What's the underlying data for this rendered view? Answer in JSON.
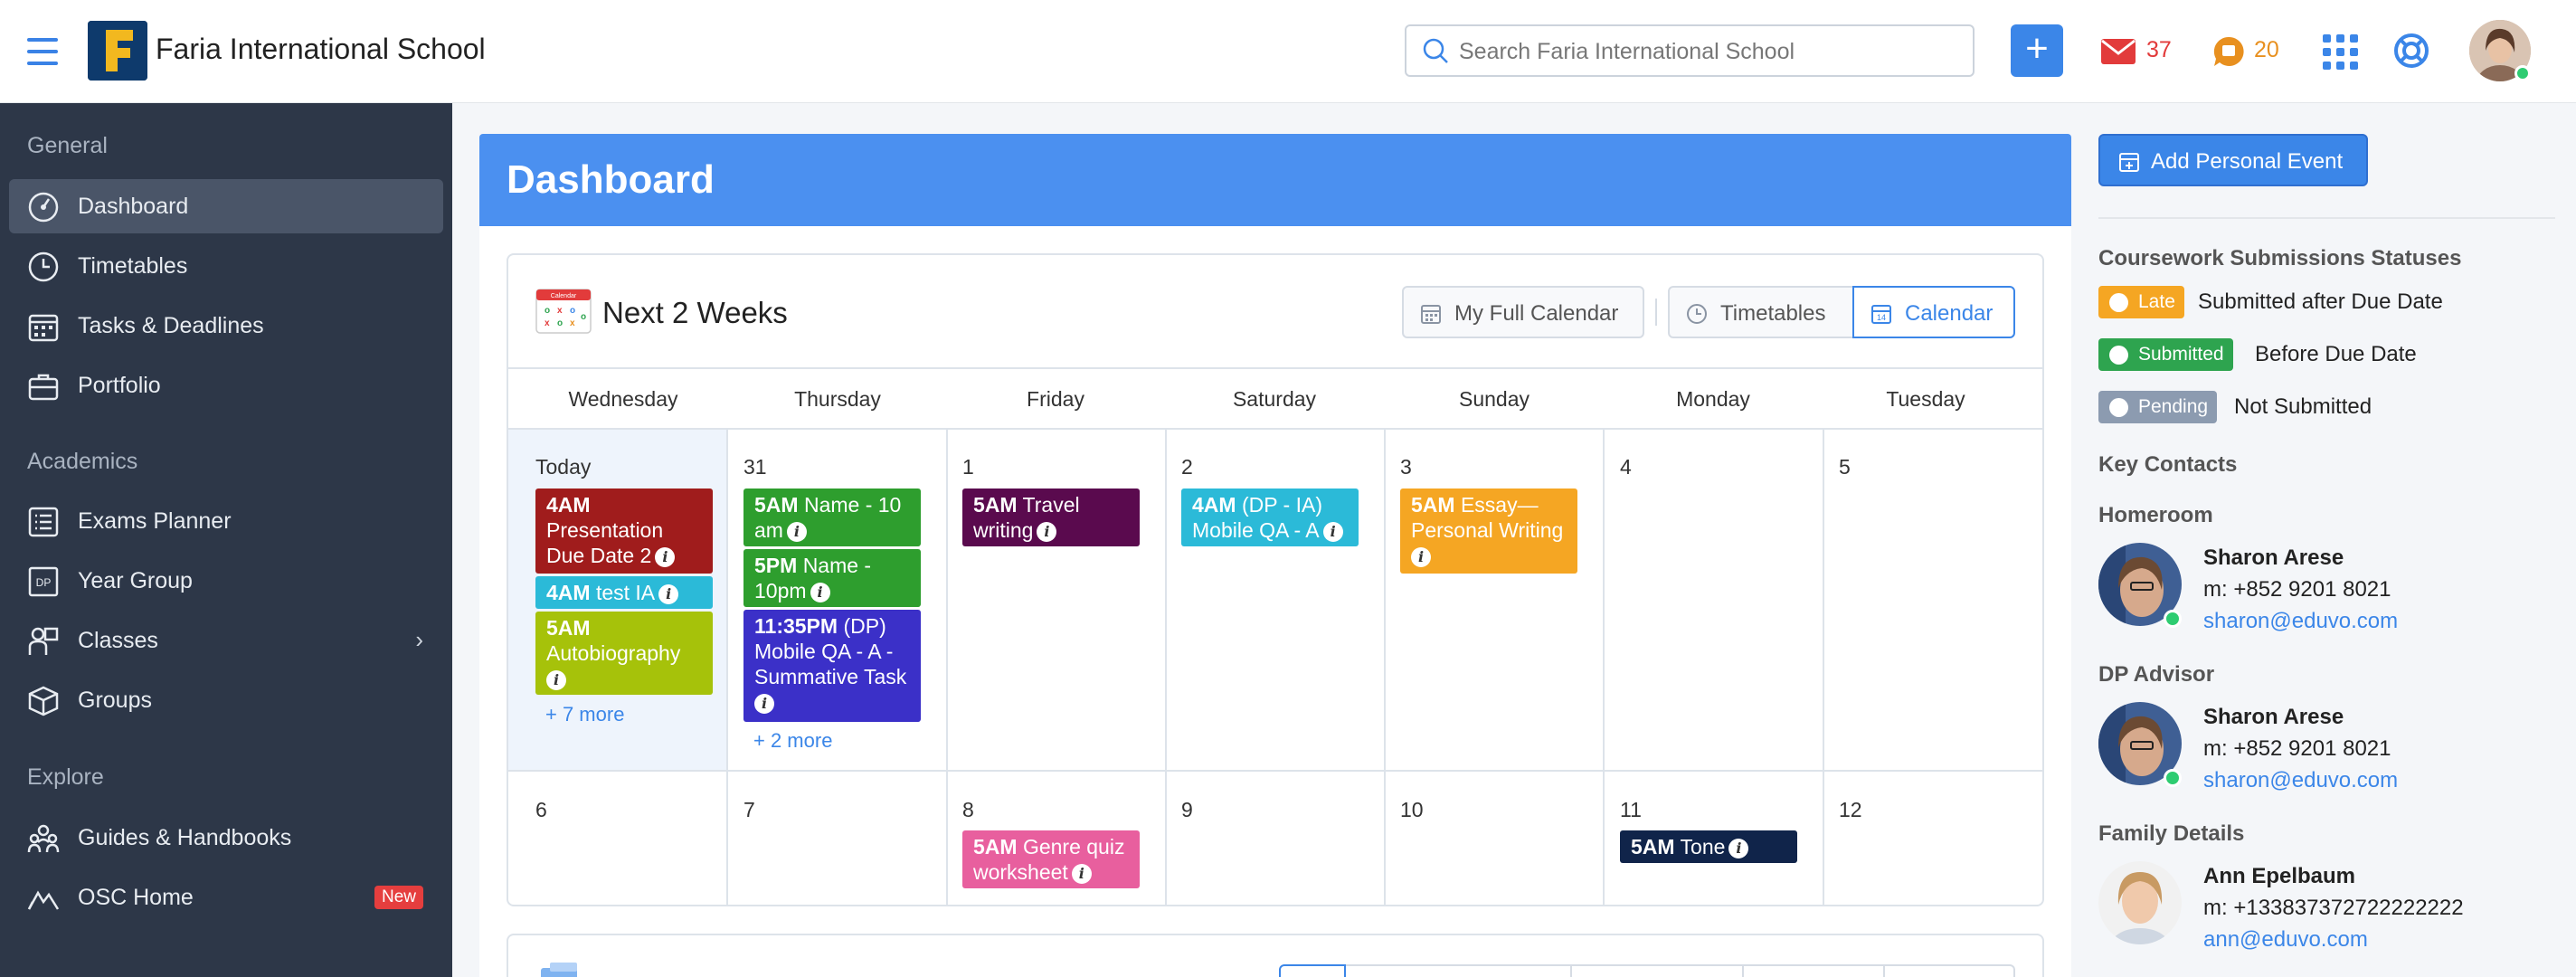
{
  "header": {
    "school_name": "Faria International School",
    "search_placeholder": "Search Faria International School",
    "plus_label": "+",
    "mail_count": "37",
    "messages_count": "20",
    "icons": [
      "menu-icon",
      "mail-icon",
      "chat-bubble-icon",
      "apps-grid-icon",
      "help-icon"
    ]
  },
  "sidebar": {
    "groups": [
      {
        "label": "General",
        "items": [
          {
            "label": "Dashboard",
            "icon": "dashboard-icon",
            "active": true
          },
          {
            "label": "Timetables",
            "icon": "clock-icon"
          },
          {
            "label": "Tasks & Deadlines",
            "icon": "calendar-icon"
          },
          {
            "label": "Portfolio",
            "icon": "briefcase-icon"
          }
        ]
      },
      {
        "label": "Academics",
        "items": [
          {
            "label": "Exams Planner",
            "icon": "list-icon"
          },
          {
            "label": "Year Group",
            "icon": "dp-icon"
          },
          {
            "label": "Classes",
            "icon": "person-board-icon",
            "chevron": "›"
          },
          {
            "label": "Groups",
            "icon": "cube-icon"
          }
        ]
      },
      {
        "label": "Explore",
        "items": [
          {
            "label": "Guides & Handbooks",
            "icon": "people-icon"
          },
          {
            "label": "OSC Home",
            "icon": "mountain-icon",
            "badge": "New"
          }
        ]
      }
    ]
  },
  "main": {
    "title": "Dashboard",
    "widget_title": "Next 2 Weeks",
    "calendar_icon_text": "Calendar",
    "buttons": {
      "full_calendar": "My Full Calendar",
      "timetables": "Timetables",
      "calendar": "Calendar"
    },
    "weekdays": [
      "Wednesday",
      "Thursday",
      "Friday",
      "Saturday",
      "Sunday",
      "Monday",
      "Tuesday"
    ],
    "week1": [
      {
        "day": "Today",
        "events": [
          {
            "time": "4AM",
            "title": "Presentation Due Date 2",
            "color": "#a01c1c"
          },
          {
            "time": "4AM",
            "title": "test IA",
            "color": "#2bbad8"
          },
          {
            "time": "5AM",
            "title": "Autobiography",
            "color": "#a6c20a"
          }
        ],
        "more": "+ 7 more"
      },
      {
        "day": "31",
        "events": [
          {
            "time": "5AM",
            "title": "Name - 10 am",
            "color": "#2e9e2e"
          },
          {
            "time": "5PM",
            "title": "Name - 10pm",
            "color": "#2e9e2e"
          },
          {
            "time": "11:35PM",
            "title": "(DP) Mobile QA - A - Summative Task",
            "color": "#3b30c8"
          }
        ],
        "more": "+ 2 more"
      },
      {
        "day": "1",
        "events": [
          {
            "time": "5AM",
            "title": "Travel writing",
            "color": "#5a0a4e"
          }
        ]
      },
      {
        "day": "2",
        "events": [
          {
            "time": "4AM",
            "title": "(DP - IA) Mobile QA - A",
            "color": "#2bbad8"
          }
        ]
      },
      {
        "day": "3",
        "events": [
          {
            "time": "5AM",
            "title": "Essay—Personal Writing",
            "color": "#f5a623"
          }
        ]
      },
      {
        "day": "4",
        "events": []
      },
      {
        "day": "5",
        "events": []
      }
    ],
    "week2": [
      {
        "day": "6",
        "events": []
      },
      {
        "day": "7",
        "events": []
      },
      {
        "day": "8",
        "events": [
          {
            "time": "5AM",
            "title": "Genre quiz worksheet",
            "color": "#e85f9e"
          }
        ]
      },
      {
        "day": "9",
        "events": []
      },
      {
        "day": "10",
        "events": []
      },
      {
        "day": "11",
        "events": [
          {
            "time": "5AM",
            "title": "Tone",
            "color": "#10244a"
          }
        ]
      },
      {
        "day": "12",
        "events": []
      }
    ]
  },
  "right": {
    "add_event": "Add Personal Event",
    "statuses_title": "Coursework Submissions Statuses",
    "statuses": [
      {
        "badge": "Late",
        "text": "Submitted after Due Date",
        "color": "#f5a623"
      },
      {
        "badge": "Submitted",
        "text": "Before Due Date",
        "color": "#2ea44f"
      },
      {
        "badge": "Pending",
        "text": "Not Submitted",
        "color": "#8c9bb0"
      }
    ],
    "contacts_title": "Key Contacts",
    "contacts": [
      {
        "role": "Homeroom",
        "name": "Sharon Arese",
        "phone": "m: +852 9201 8021",
        "email": "sharon@eduvo.com",
        "online": true
      },
      {
        "role": "DP Advisor",
        "name": "Sharon Arese",
        "phone": "m: +852 9201 8021",
        "email": "sharon@eduvo.com",
        "online": true
      },
      {
        "role": "Family Details",
        "name": "Ann Epelbaum",
        "phone": "m: +133837372722222222",
        "email": "ann@eduvo.com",
        "online": false
      }
    ]
  }
}
